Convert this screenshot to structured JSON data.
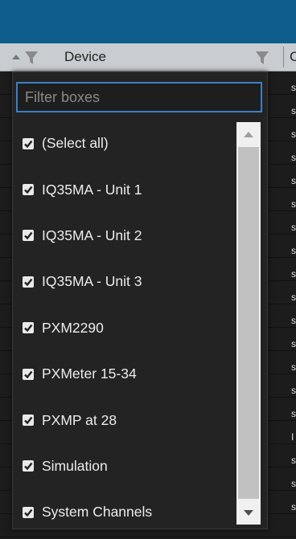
{
  "header": {
    "column_device": "Device",
    "column_next": "C"
  },
  "grid": {
    "marks": [
      "s",
      "s",
      "s",
      "s",
      "s",
      "s",
      "s",
      "s",
      "s",
      "s",
      "s",
      "s",
      "s",
      "s",
      "s",
      "I",
      "s",
      "s",
      "s"
    ]
  },
  "filter": {
    "placeholder": "Filter boxes",
    "value": ""
  },
  "options": [
    {
      "label": "(Select all)",
      "checked": true
    },
    {
      "label": "IQ35MA - Unit 1",
      "checked": true
    },
    {
      "label": "IQ35MA - Unit 2",
      "checked": true
    },
    {
      "label": "IQ35MA - Unit 3",
      "checked": true
    },
    {
      "label": "PXM2290",
      "checked": true
    },
    {
      "label": "PXMeter 15-34",
      "checked": true
    },
    {
      "label": "PXMP at 28",
      "checked": true
    },
    {
      "label": "Simulation",
      "checked": true
    },
    {
      "label": "System Channels",
      "checked": true
    }
  ],
  "colors": {
    "topbar": "#0f5d8c",
    "popup_bg": "#232323",
    "focus_border": "#3d7fc4"
  },
  "icons": {
    "sort": "sort-ascending-icon",
    "filter": "funnel-icon",
    "check": "check-icon",
    "scroll_up": "scroll-up-arrow-icon",
    "scroll_down": "scroll-down-arrow-icon"
  }
}
